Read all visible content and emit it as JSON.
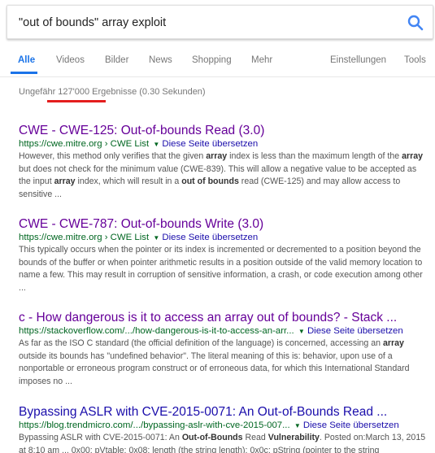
{
  "search": {
    "query": "\"out of bounds\" array exploit"
  },
  "tabs": [
    {
      "label": "Alle"
    },
    {
      "label": "Videos"
    },
    {
      "label": "Bilder"
    },
    {
      "label": "News"
    },
    {
      "label": "Shopping"
    },
    {
      "label": "Mehr"
    },
    {
      "label": "Einstellungen"
    },
    {
      "label": "Tools"
    }
  ],
  "stats": {
    "text": "Ungefähr 127'000 Ergebnisse (0.30 Sekunden)"
  },
  "translate_label": "Diese Seite übersetzen",
  "results": [
    {
      "title": "CWE - CWE-125: Out-of-bounds Read (3.0)",
      "url": "https://cwe.mitre.org › CWE List",
      "snippet_parts": [
        {
          "t": "However, this method only verifies that the given ",
          "b": false
        },
        {
          "t": "array",
          "b": true
        },
        {
          "t": " index is less than the maximum length of the ",
          "b": false
        },
        {
          "t": "array",
          "b": true
        },
        {
          "t": " but does not check for the minimum value (CWE-839). This will allow a negative value to be accepted as the input ",
          "b": false
        },
        {
          "t": "array",
          "b": true
        },
        {
          "t": " index, which will result in a ",
          "b": false
        },
        {
          "t": "out of bounds",
          "b": true
        },
        {
          "t": " read (CWE-125) and may allow access to sensitive ...",
          "b": false
        }
      ]
    },
    {
      "title": "CWE - CWE-787: Out-of-bounds Write (3.0)",
      "url": "https://cwe.mitre.org › CWE List",
      "snippet_parts": [
        {
          "t": "This typically occurs when the pointer or its index is incremented or decremented to a position beyond the bounds of the buffer or when pointer arithmetic results in a position outside of the valid memory location to name a few. This may result in corruption of sensitive information, a crash, or code execution among other ...",
          "b": false
        }
      ]
    },
    {
      "title": "c - How dangerous is it to access an array out of bounds? - Stack ...",
      "url": "https://stackoverflow.com/.../how-dangerous-is-it-to-access-an-arr...",
      "snippet_parts": [
        {
          "t": "As far as the ISO C standard (the official definition of the language) is concerned, accessing an ",
          "b": false
        },
        {
          "t": "array",
          "b": true
        },
        {
          "t": " outside its bounds has \"undefined behavior\". The literal meaning of this is: behavior, upon use of a nonportable or erroneous program construct or of erroneous data, for which this International Standard imposes no ...",
          "b": false
        }
      ]
    },
    {
      "title": "Bypassing ASLR with CVE-2015-0071: An Out-of-Bounds Read ...",
      "url": "https://blog.trendmicro.com/.../bypassing-aslr-with-cve-2015-007...",
      "snippet_parts": [
        {
          "t": "Bypassing ASLR with CVE-2015-0071: An ",
          "b": false
        },
        {
          "t": "Out-of-Bounds",
          "b": true
        },
        {
          "t": " Read ",
          "b": false
        },
        {
          "t": "Vulnerability",
          "b": true
        },
        {
          "t": ". Posted on:March 13, 2015 at 8:10 am ... 0x00: pVtable; 0x08: length (the string length); 0x0c: pString (pointer to the string",
          "b": false
        }
      ]
    }
  ],
  "colors": {
    "accent": "#1a73e8",
    "visited_title": "#660099",
    "link_title": "#1a0dab",
    "url_green": "#006621",
    "highlight_red": "#e41e1e"
  }
}
